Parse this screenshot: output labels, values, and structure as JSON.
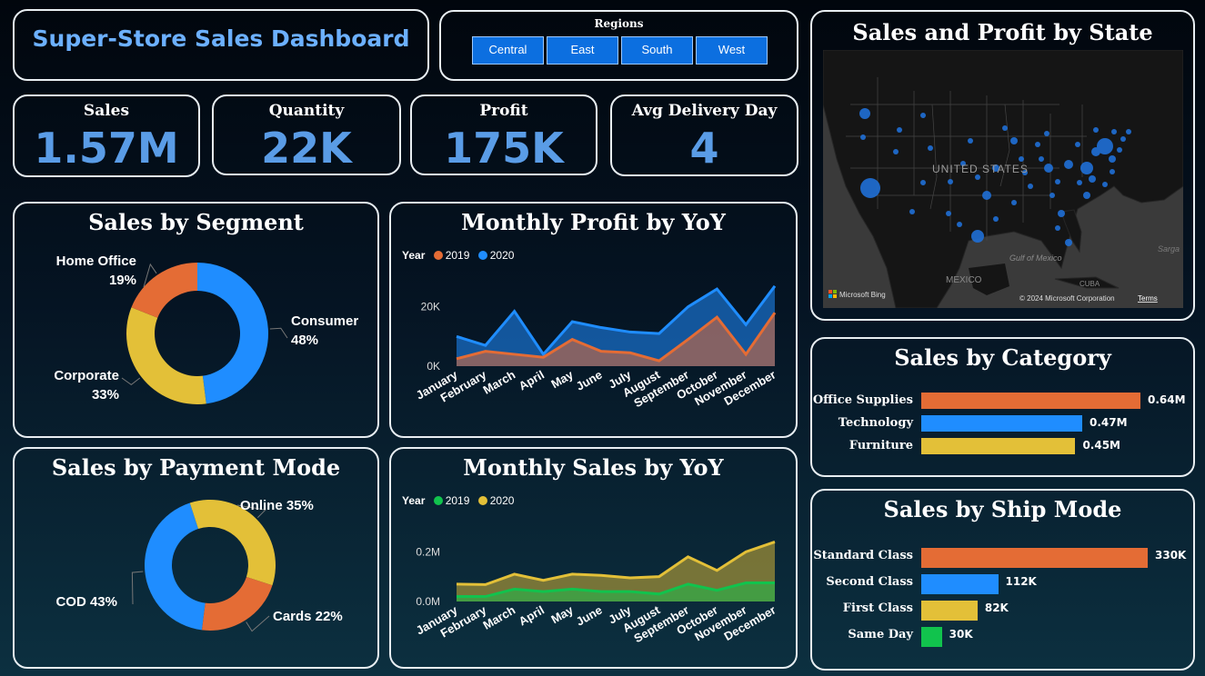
{
  "title": "Super-Store Sales Dashboard",
  "regions": {
    "label": "Regions",
    "items": [
      "Central",
      "East",
      "South",
      "West"
    ]
  },
  "kpis": [
    {
      "label": "Sales",
      "value": "1.57M"
    },
    {
      "label": "Quantity",
      "value": "22K"
    },
    {
      "label": "Profit",
      "value": "175K"
    },
    {
      "label": "Avg Delivery Day",
      "value": "4"
    }
  ],
  "colors": {
    "orange": "#e46c35",
    "blue": "#1f8dff",
    "yellow": "#e3c038",
    "green": "#11c34d",
    "accent": "#5a9ce6",
    "kpi_title": "#6cb0ff"
  },
  "map": {
    "title": "Sales and Profit by State",
    "country_label": "UNITED STATES",
    "gulf_label": "Gulf of Mexico",
    "mexico_label": "MEXICO",
    "cuba_label": "CUBA",
    "sargasso_label": "Sarga",
    "bing": "Microsoft Bing",
    "copyright": "© 2024 Microsoft Corporation",
    "terms": "Terms"
  },
  "chart_data": [
    {
      "id": "segment",
      "type": "pie",
      "title": "Sales by Segment",
      "labels": [
        "Consumer",
        "Corporate",
        "Home Office"
      ],
      "values": [
        48,
        33,
        19
      ],
      "value_labels": [
        "48%",
        "33%",
        "19%"
      ],
      "colors": [
        "#1f8dff",
        "#e3c038",
        "#e46c35"
      ]
    },
    {
      "id": "profit",
      "type": "area",
      "title": "Monthly Profit by YoY",
      "legend_title": "Year",
      "x": [
        "January",
        "February",
        "March",
        "April",
        "May",
        "June",
        "July",
        "August",
        "September",
        "October",
        "November",
        "December"
      ],
      "yticks": [
        "0K",
        "20K"
      ],
      "ylim": [
        0,
        30000
      ],
      "series": [
        {
          "name": "2019",
          "color": "#e46c35",
          "values": [
            2500,
            5000,
            4000,
            3000,
            9000,
            5000,
            4500,
            1800,
            9000,
            16500,
            4000,
            18000
          ]
        },
        {
          "name": "2020",
          "color": "#1f8dff",
          "values": [
            10000,
            7000,
            18500,
            4000,
            15000,
            13000,
            11500,
            11000,
            20000,
            26000,
            14000,
            27000
          ]
        }
      ]
    },
    {
      "id": "payment",
      "type": "pie",
      "title": "Sales by Payment Mode",
      "labels": [
        "COD",
        "Online",
        "Cards"
      ],
      "values": [
        43,
        35,
        22
      ],
      "value_labels": [
        "COD 43%",
        "Online 35%",
        "Cards 22%"
      ],
      "colors": [
        "#1f8dff",
        "#e3c038",
        "#e46c35"
      ]
    },
    {
      "id": "sales",
      "type": "area",
      "title": "Monthly Sales by YoY",
      "legend_title": "Year",
      "x": [
        "January",
        "February",
        "March",
        "April",
        "May",
        "June",
        "July",
        "August",
        "September",
        "October",
        "November",
        "December"
      ],
      "yticks": [
        "0.0M",
        "0.2M"
      ],
      "ylim": [
        0,
        0.3
      ],
      "series": [
        {
          "name": "2019",
          "color": "#11c34d",
          "values": [
            0.02,
            0.02,
            0.05,
            0.04,
            0.05,
            0.04,
            0.04,
            0.03,
            0.07,
            0.045,
            0.075,
            0.075
          ]
        },
        {
          "name": "2020",
          "color": "#e3c038",
          "values": [
            0.07,
            0.068,
            0.11,
            0.085,
            0.11,
            0.105,
            0.095,
            0.1,
            0.18,
            0.125,
            0.2,
            0.24
          ]
        }
      ]
    },
    {
      "id": "category",
      "type": "bar",
      "title": "Sales by Category",
      "categories": [
        "Office Supplies",
        "Technology",
        "Furniture"
      ],
      "values": [
        0.64,
        0.47,
        0.45
      ],
      "value_labels": [
        "0.64M",
        "0.47M",
        "0.45M"
      ],
      "colors": [
        "#e46c35",
        "#1f8dff",
        "#e3c038"
      ],
      "xlim": [
        0,
        0.64
      ]
    },
    {
      "id": "shipmode",
      "type": "bar",
      "title": "Sales by Ship Mode",
      "categories": [
        "Standard Class",
        "Second Class",
        "First Class",
        "Same Day"
      ],
      "values": [
        330,
        112,
        82,
        30
      ],
      "value_labels": [
        "330K",
        "112K",
        "82K",
        "30K"
      ],
      "colors": [
        "#e46c35",
        "#1f8dff",
        "#e3c038",
        "#11c34d"
      ],
      "xlim": [
        0,
        330
      ]
    }
  ]
}
